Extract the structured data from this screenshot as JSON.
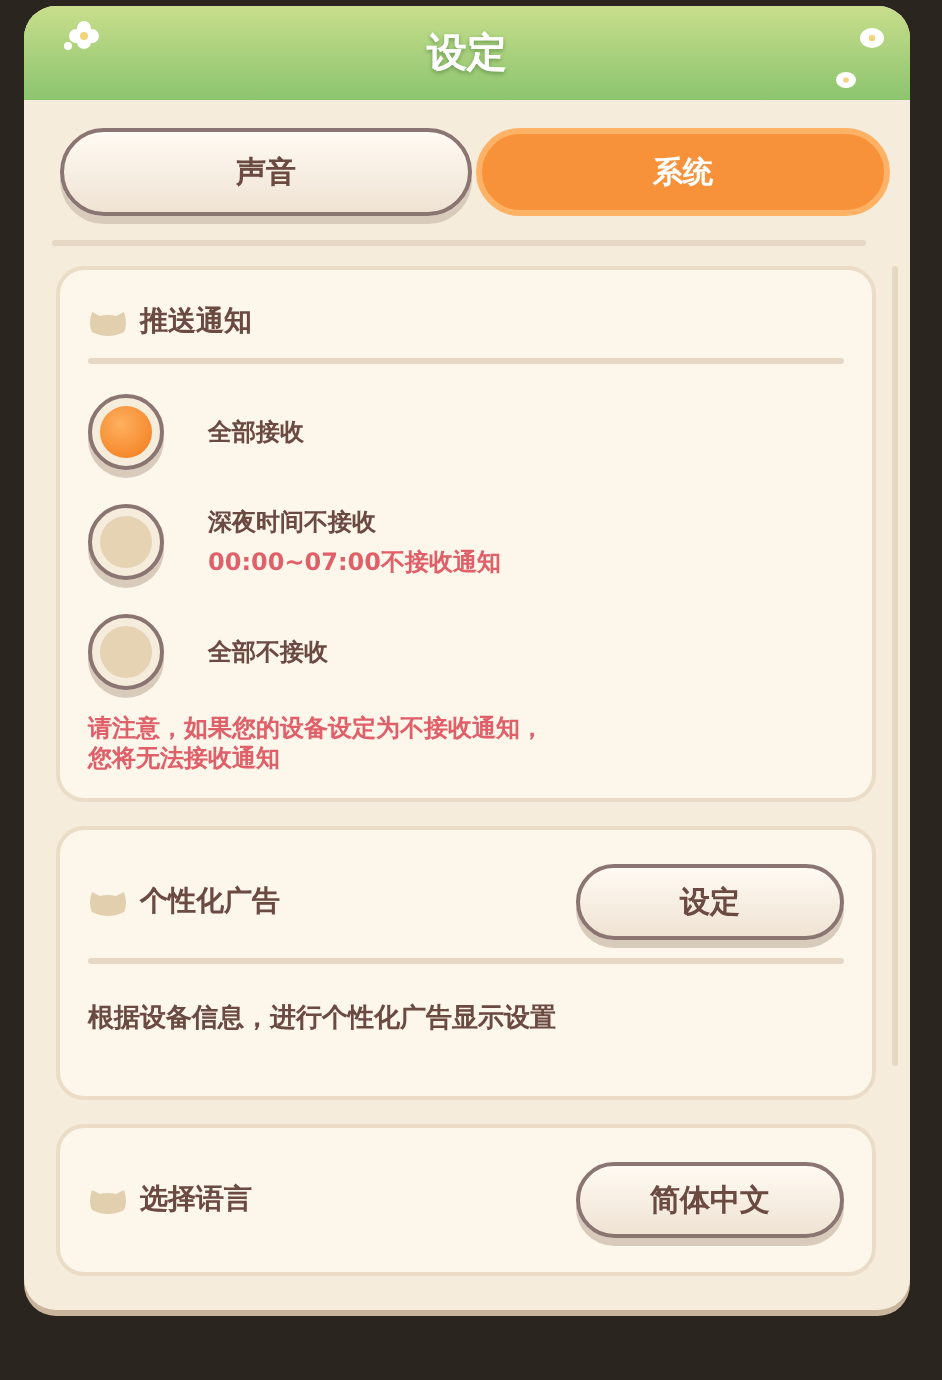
{
  "window": {
    "title": "设定"
  },
  "tabs": [
    {
      "label": "声音",
      "selected": false
    },
    {
      "label": "系统",
      "selected": true
    }
  ],
  "push_notifications": {
    "title": "推送通知",
    "options": [
      {
        "label": "全部接收",
        "selected": true
      },
      {
        "label": "深夜时间不接收",
        "note": "00:00~07:00不接收通知",
        "selected": false
      },
      {
        "label": "全部不接收",
        "selected": false
      }
    ],
    "warning_lines": [
      "请注意，如果您的设备设定为不接收通知，",
      "您将无法接收通知"
    ]
  },
  "personalized_ads": {
    "title": "个性化广告",
    "button": "设定",
    "description": "根据设备信息，进行个性化广告显示设置"
  },
  "language": {
    "title": "选择语言",
    "button": "简体中文"
  }
}
